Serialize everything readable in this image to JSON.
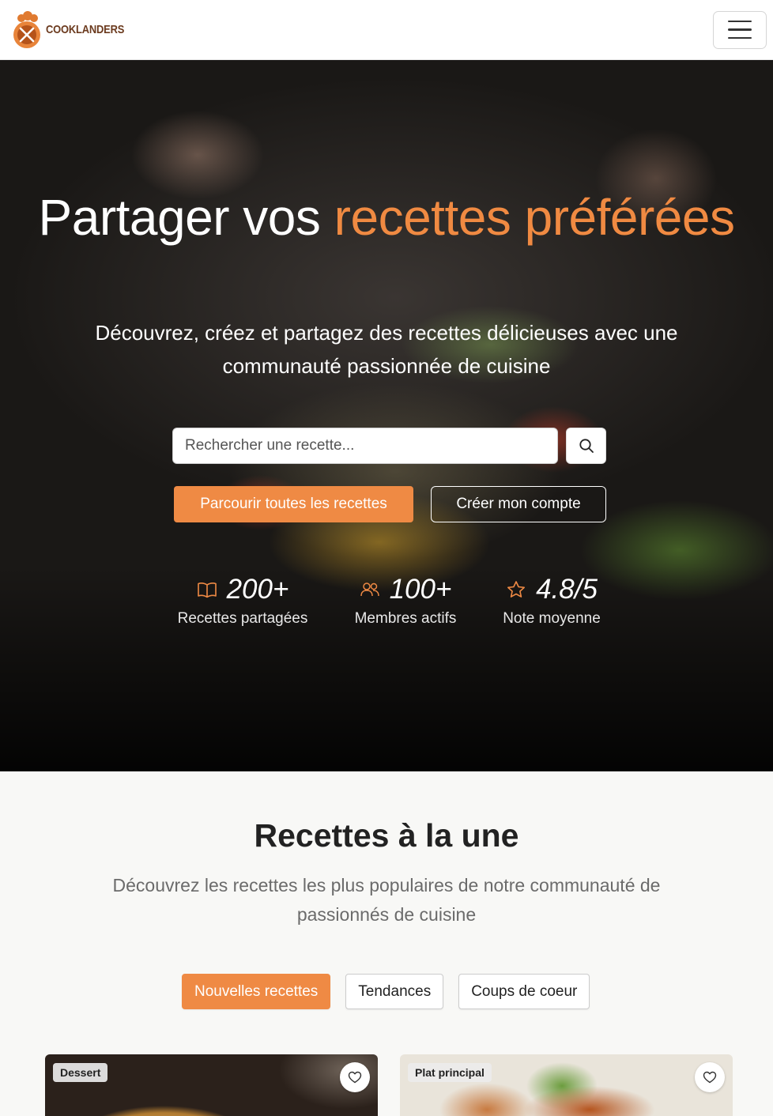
{
  "navbar": {
    "brand_name": "COOKLANDERS",
    "menu_icon": "hamburger-menu-icon"
  },
  "hero": {
    "title_part1": "Partager vos",
    "title_accent": "recettes préférées",
    "subtitle": "Découvrez, créez et partagez des recettes délicieuses avec une communauté passionnée de cuisine",
    "search": {
      "placeholder": "Rechercher une recette...",
      "icon": "search-icon"
    },
    "primary_button": "Parcourir toutes les recettes",
    "secondary_button": "Créer mon compte",
    "stats": [
      {
        "icon": "book-icon",
        "value": "200+",
        "label": "Recettes partagées"
      },
      {
        "icon": "users-icon",
        "value": "100+",
        "label": "Membres actifs"
      },
      {
        "icon": "star-icon",
        "value": "4.8/5",
        "label": "Note moyenne"
      }
    ]
  },
  "featured": {
    "title": "Recettes à la une",
    "subtitle": "Découvrez les recettes les plus populaires de notre communauté de passionnés de cuisine",
    "tabs": [
      {
        "label": "Nouvelles recettes",
        "active": true
      },
      {
        "label": "Tendances",
        "active": false
      },
      {
        "label": "Coups de coeur",
        "active": false
      }
    ],
    "cards": [
      {
        "category": "Dessert"
      },
      {
        "category": "Plat principal"
      }
    ]
  },
  "colors": {
    "accent": "#ef8a44",
    "brand_text": "#6b3a1e"
  }
}
